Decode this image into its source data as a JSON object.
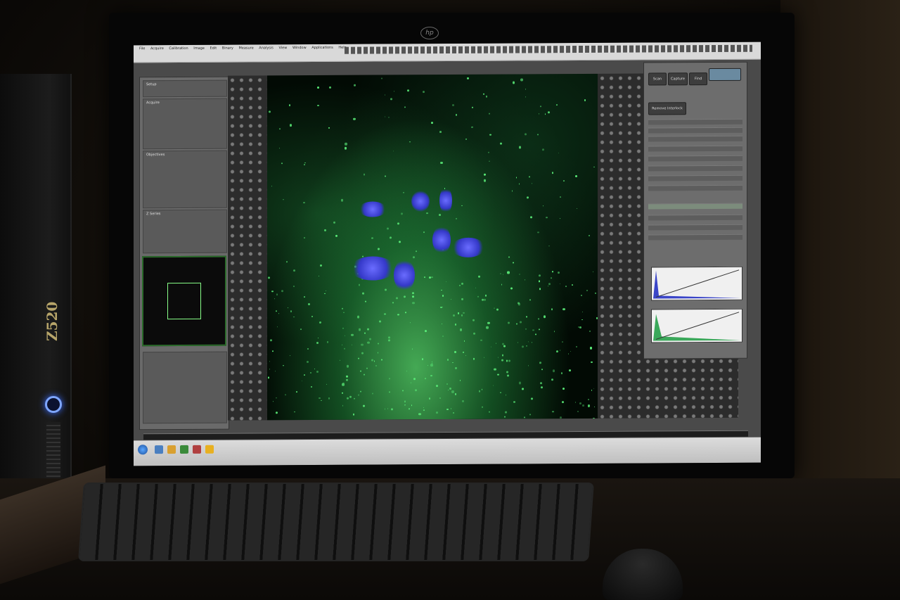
{
  "computer": {
    "tower_label": "Z520",
    "monitor_logo": "hp"
  },
  "app": {
    "menu": [
      "File",
      "Acquire",
      "Calibration",
      "Image",
      "Edit",
      "Binary",
      "Measure",
      "Analysis",
      "View",
      "Window",
      "Applications",
      "Help"
    ],
    "left_panel": {
      "tab_label": "Setup",
      "section_labels": [
        "Acquire",
        "Objectives",
        "Z Series"
      ]
    },
    "right_panel": {
      "buttons": [
        "Scan",
        "Capture",
        "Find",
        "Remove Interlock"
      ],
      "histogram_count": 2
    },
    "image": {
      "channels": [
        "green",
        "blue"
      ],
      "colors": {
        "green": "#5cf07a",
        "blue": "#4b4fe8",
        "background": "#020a04"
      }
    },
    "taskbar": {
      "start_icon": "windows-orb-icon"
    }
  }
}
